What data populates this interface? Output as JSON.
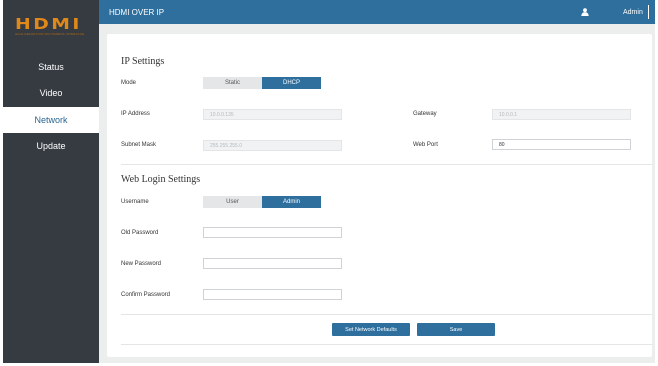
{
  "sidebar": {
    "logo": {
      "brand": "HDMI",
      "tagline": "HIGH-DEFINITION MULTIMEDIA INTERFACE"
    },
    "items": [
      {
        "label": "Status",
        "active": false
      },
      {
        "label": "Video",
        "active": false
      },
      {
        "label": "Network",
        "active": true
      },
      {
        "label": "Update",
        "active": false
      }
    ]
  },
  "header": {
    "title": "HDMI OVER IP",
    "user_icon": "user-icon",
    "user": "Admin"
  },
  "ip_settings": {
    "title": "IP Settings",
    "mode": {
      "label": "Mode",
      "options": [
        "Static",
        "DHCP"
      ],
      "selected": "DHCP"
    },
    "ip_address": {
      "label": "IP Address",
      "value": "10.0.0.135"
    },
    "gateway": {
      "label": "Gateway",
      "value": "10.0.0.1"
    },
    "subnet_mask": {
      "label": "Subnet Mask",
      "value": "255.255.255.0"
    },
    "web_port": {
      "label": "Web Port",
      "value": "80"
    }
  },
  "web_login": {
    "title": "Web Login Settings",
    "username": {
      "label": "Username",
      "options": [
        "User",
        "Admin"
      ],
      "selected": "Admin"
    },
    "old_password": {
      "label": "Old Password",
      "value": ""
    },
    "new_password": {
      "label": "New Password",
      "value": ""
    },
    "confirm_password": {
      "label": "Confirm Password",
      "value": ""
    }
  },
  "actions": {
    "defaults_label": "Set Network Defaults",
    "save_label": "Save"
  },
  "colors": {
    "accent": "#2f6f9e",
    "sidebar": "#363b42",
    "logo": "#e0891a",
    "background": "#eceded"
  }
}
